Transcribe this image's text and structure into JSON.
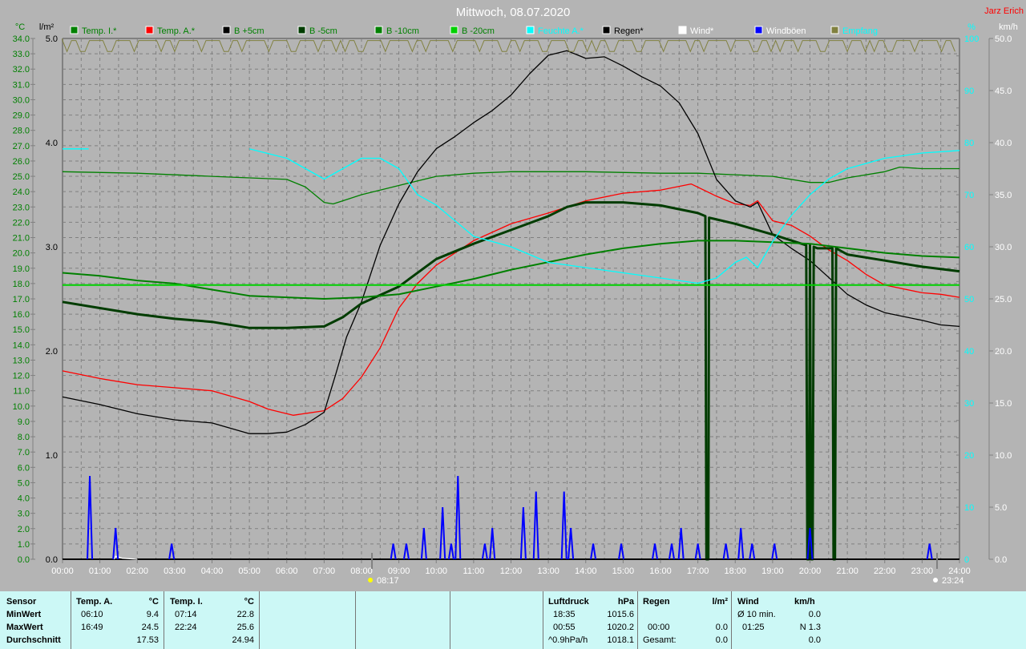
{
  "header": {
    "title": "Mittwoch, 08.07.2020",
    "author": "Jarz Erich"
  },
  "colors": {
    "temp_i": "#008000",
    "temp_a": "#ff0000",
    "b5": "#000000",
    "bm5": "#003c00",
    "bm10": "#008000",
    "bm20": "#00d000",
    "feuchte": "#00ffff",
    "regen": "#000000",
    "wind": "#ffffff",
    "windboeen": "#0000ff",
    "empfang": "#808040"
  },
  "chart_data": {
    "type": "line",
    "title": "Mittwoch, 08.07.2020",
    "xlabel": "",
    "x_range_hours": [
      0,
      24
    ],
    "x_ticks": [
      "00:00",
      "01:00",
      "02:00",
      "03:00",
      "04:00",
      "05:00",
      "06:00",
      "07:00",
      "08:00",
      "09:00",
      "10:00",
      "11:00",
      "12:00",
      "13:00",
      "14:00",
      "15:00",
      "16:00",
      "17:00",
      "18:00",
      "19:00",
      "20:00",
      "21:00",
      "22:00",
      "23:00",
      "24:00"
    ],
    "axes": {
      "temp": {
        "unit": "°C",
        "range": [
          0,
          34
        ],
        "ticks": [
          "0.0",
          "1.0",
          "2.0",
          "3.0",
          "4.0",
          "5.0",
          "6.0",
          "7.0",
          "8.0",
          "9.0",
          "10.0",
          "11.0",
          "12.0",
          "13.0",
          "14.0",
          "15.0",
          "16.0",
          "17.0",
          "18.0",
          "19.0",
          "20.0",
          "21.0",
          "22.0",
          "23.0",
          "24.0",
          "25.0",
          "26.0",
          "27.0",
          "28.0",
          "29.0",
          "30.0",
          "31.0",
          "32.0",
          "33.0",
          "34.0"
        ]
      },
      "rain": {
        "unit": "l/m²",
        "range": [
          0,
          5
        ],
        "ticks": [
          "0.0",
          "1.0",
          "2.0",
          "3.0",
          "4.0",
          "5.0"
        ]
      },
      "humidity": {
        "unit": "%",
        "range": [
          0,
          100
        ],
        "ticks": [
          "0",
          "10",
          "20",
          "30",
          "40",
          "50",
          "60",
          "70",
          "80",
          "90",
          "100"
        ]
      },
      "wind": {
        "unit": "km/h",
        "range": [
          0,
          50
        ],
        "ticks": [
          "0.0",
          "5.0",
          "10.0",
          "15.0",
          "20.0",
          "25.0",
          "30.0",
          "35.0",
          "40.0",
          "45.0",
          "50.0"
        ]
      }
    },
    "grid": true,
    "legend_position": "top",
    "legend": [
      "Temp. I.*",
      "Temp. A.*",
      "B +5cm",
      "B -5cm",
      "B -10cm",
      "B -20cm",
      "Feuchte A.*",
      "Regen*",
      "Wind*",
      "Windböen",
      "Empfang"
    ],
    "series": [
      {
        "name": "Temp. I.*",
        "axis": "temp",
        "color_key": "temp_i",
        "points": [
          [
            0,
            25.3
          ],
          [
            2,
            25.2
          ],
          [
            4,
            25.0
          ],
          [
            5,
            24.9
          ],
          [
            6,
            24.8
          ],
          [
            6.5,
            24.3
          ],
          [
            7,
            23.3
          ],
          [
            7.24,
            23.2
          ],
          [
            7.5,
            23.4
          ],
          [
            8,
            23.8
          ],
          [
            9,
            24.4
          ],
          [
            10,
            25.0
          ],
          [
            11,
            25.2
          ],
          [
            12,
            25.3
          ],
          [
            14,
            25.3
          ],
          [
            16,
            25.2
          ],
          [
            17,
            25.2
          ],
          [
            18,
            25.1
          ],
          [
            19,
            25.0
          ],
          [
            20,
            24.6
          ],
          [
            20.5,
            24.6
          ],
          [
            21,
            24.9
          ],
          [
            22,
            25.3
          ],
          [
            22.4,
            25.6
          ],
          [
            23,
            25.5
          ],
          [
            24,
            25.5
          ]
        ]
      },
      {
        "name": "Temp. A.*",
        "axis": "temp",
        "color_key": "temp_a",
        "points": [
          [
            0,
            12.3
          ],
          [
            1,
            11.8
          ],
          [
            2,
            11.4
          ],
          [
            3,
            11.2
          ],
          [
            4,
            11.0
          ],
          [
            5,
            10.3
          ],
          [
            5.5,
            9.8
          ],
          [
            6.17,
            9.4
          ],
          [
            7,
            9.7
          ],
          [
            7.5,
            10.5
          ],
          [
            8,
            11.9
          ],
          [
            8.5,
            13.8
          ],
          [
            9,
            16.4
          ],
          [
            9.5,
            18
          ],
          [
            10,
            19.2
          ],
          [
            11,
            20.8
          ],
          [
            12,
            21.9
          ],
          [
            13,
            22.6
          ],
          [
            14,
            23.4
          ],
          [
            15,
            23.9
          ],
          [
            16,
            24.1
          ],
          [
            16.82,
            24.5
          ],
          [
            17.5,
            23.7
          ],
          [
            18,
            23.2
          ],
          [
            18.4,
            23.1
          ],
          [
            18.6,
            23.4
          ],
          [
            19,
            22.1
          ],
          [
            19.5,
            21.8
          ],
          [
            20,
            21.1
          ],
          [
            20.5,
            20.2
          ],
          [
            21,
            19.5
          ],
          [
            21.5,
            18.6
          ],
          [
            22,
            17.9
          ],
          [
            23,
            17.4
          ],
          [
            23.5,
            17.3
          ],
          [
            24,
            17.1
          ]
        ]
      },
      {
        "name": "B +5cm",
        "axis": "temp",
        "color_key": "b5",
        "points": [
          [
            0,
            10.6
          ],
          [
            1,
            10.1
          ],
          [
            2,
            9.5
          ],
          [
            3,
            9.1
          ],
          [
            4,
            8.9
          ],
          [
            5,
            8.2
          ],
          [
            5.5,
            8.2
          ],
          [
            6,
            8.3
          ],
          [
            6.5,
            8.8
          ],
          [
            7,
            9.6
          ],
          [
            7.3,
            12
          ],
          [
            7.6,
            14.5
          ],
          [
            8,
            16.8
          ],
          [
            8.5,
            20.5
          ],
          [
            9,
            23.2
          ],
          [
            9.5,
            25.3
          ],
          [
            10,
            26.8
          ],
          [
            10.5,
            27.6
          ],
          [
            11,
            28.5
          ],
          [
            11.5,
            29.3
          ],
          [
            12,
            30.3
          ],
          [
            12.5,
            31.7
          ],
          [
            13,
            32.9
          ],
          [
            13.5,
            33.2
          ],
          [
            13.8,
            32.9
          ],
          [
            14,
            32.7
          ],
          [
            14.5,
            32.8
          ],
          [
            15,
            32.2
          ],
          [
            15.5,
            31.5
          ],
          [
            16,
            30.9
          ],
          [
            16.5,
            29.8
          ],
          [
            17,
            27.8
          ],
          [
            17.5,
            24.8
          ],
          [
            18,
            23.4
          ],
          [
            18.4,
            23.0
          ],
          [
            18.6,
            23.3
          ],
          [
            19,
            21.2
          ],
          [
            19.5,
            20.3
          ],
          [
            20,
            19.5
          ],
          [
            20.5,
            18.4
          ],
          [
            21,
            17.3
          ],
          [
            21.5,
            16.6
          ],
          [
            22,
            16.1
          ],
          [
            23,
            15.6
          ],
          [
            23.5,
            15.3
          ],
          [
            24,
            15.2
          ]
        ]
      },
      {
        "name": "B -5cm",
        "axis": "temp",
        "color_key": "bm5",
        "width": 3,
        "points": [
          [
            0,
            16.8
          ],
          [
            1,
            16.4
          ],
          [
            2,
            16.0
          ],
          [
            3,
            15.7
          ],
          [
            4,
            15.5
          ],
          [
            5,
            15.1
          ],
          [
            6,
            15.1
          ],
          [
            7,
            15.2
          ],
          [
            7.5,
            15.8
          ],
          [
            8,
            16.7
          ],
          [
            9,
            17.8
          ],
          [
            10,
            19.6
          ],
          [
            11,
            20.6
          ],
          [
            12,
            21.5
          ],
          [
            13,
            22.4
          ],
          [
            13.5,
            23.0
          ],
          [
            14,
            23.3
          ],
          [
            15,
            23.3
          ],
          [
            16,
            23.1
          ],
          [
            17,
            22.6
          ],
          [
            17.2,
            22.4
          ],
          [
            17.23,
            0
          ],
          [
            17.28,
            0
          ],
          [
            17.3,
            22.3
          ],
          [
            18,
            21.9
          ],
          [
            19,
            21.2
          ],
          [
            19.9,
            20.5
          ],
          [
            19.93,
            0
          ],
          [
            19.97,
            0
          ],
          [
            20,
            20.5
          ],
          [
            20.03,
            0
          ],
          [
            20.07,
            0
          ],
          [
            20.1,
            20.4
          ],
          [
            20.2,
            20.3
          ],
          [
            20.6,
            20.3
          ],
          [
            20.63,
            0
          ],
          [
            20.67,
            0
          ],
          [
            20.7,
            20.3
          ],
          [
            21,
            19.9
          ],
          [
            22,
            19.5
          ],
          [
            23,
            19.1
          ],
          [
            24,
            18.8
          ]
        ]
      },
      {
        "name": "B -10cm",
        "axis": "temp",
        "color_key": "bm10",
        "width": 2,
        "points": [
          [
            0,
            18.7
          ],
          [
            1,
            18.5
          ],
          [
            2,
            18.2
          ],
          [
            3,
            18.0
          ],
          [
            4,
            17.6
          ],
          [
            5,
            17.2
          ],
          [
            6,
            17.1
          ],
          [
            7,
            17.0
          ],
          [
            8,
            17.1
          ],
          [
            9,
            17.3
          ],
          [
            10,
            17.8
          ],
          [
            11,
            18.3
          ],
          [
            12,
            18.9
          ],
          [
            13,
            19.4
          ],
          [
            14,
            19.9
          ],
          [
            15,
            20.3
          ],
          [
            16,
            20.6
          ],
          [
            17,
            20.8
          ],
          [
            18,
            20.8
          ],
          [
            19,
            20.7
          ],
          [
            20,
            20.6
          ],
          [
            21,
            20.3
          ],
          [
            22,
            20.0
          ],
          [
            23,
            19.8
          ],
          [
            24,
            19.7
          ]
        ]
      },
      {
        "name": "B -20cm",
        "axis": "temp",
        "color_key": "bm20",
        "width": 2,
        "points": [
          [
            0,
            17.9
          ],
          [
            24,
            17.9
          ]
        ]
      },
      {
        "name": "Feuchte A.*",
        "axis": "humidity",
        "color_key": "feuchte",
        "points": [
          [
            0,
            78.8
          ],
          [
            0.7,
            78.8
          ],
          null,
          [
            5,
            78.8
          ],
          [
            6,
            77
          ],
          [
            6.5,
            75
          ],
          [
            7,
            73
          ],
          [
            7.5,
            75
          ],
          [
            8,
            77
          ],
          [
            8.5,
            77
          ],
          [
            9,
            75
          ],
          [
            9.5,
            70
          ],
          [
            10,
            68
          ],
          [
            10.5,
            65
          ],
          [
            11,
            62
          ],
          [
            12,
            60
          ],
          [
            13,
            57
          ],
          [
            14,
            56
          ],
          [
            15,
            55
          ],
          [
            16,
            54
          ],
          [
            17,
            53
          ],
          [
            17.5,
            54
          ],
          [
            18,
            57
          ],
          [
            18.3,
            58
          ],
          [
            18.6,
            56
          ],
          [
            19,
            61
          ],
          [
            19.5,
            66
          ],
          [
            20,
            70
          ],
          [
            20.5,
            73
          ],
          [
            21,
            75
          ],
          [
            22,
            77
          ],
          [
            23,
            78
          ],
          [
            24,
            78.5
          ]
        ]
      },
      {
        "name": "Regen*",
        "axis": "rain",
        "color_key": "regen",
        "points": [
          [
            0,
            0
          ],
          [
            24,
            0
          ]
        ]
      },
      {
        "name": "Wind*",
        "axis": "wind",
        "color_key": "wind",
        "points": [
          [
            1.38,
            0
          ],
          [
            1.42,
            0.3
          ],
          [
            1.6,
            0.1
          ],
          [
            2,
            0
          ]
        ]
      },
      {
        "name": "Windböen",
        "axis": "wind",
        "color_key": "windboeen",
        "spikes": [
          [
            0.73,
            8.0
          ],
          [
            1.42,
            3.0
          ],
          [
            2.92,
            1.5
          ],
          [
            8.85,
            1.5
          ],
          [
            9.2,
            1.5
          ],
          [
            9.67,
            3.0
          ],
          [
            10.17,
            5.0
          ],
          [
            10.4,
            1.5
          ],
          [
            10.58,
            8.0
          ],
          [
            11.3,
            1.5
          ],
          [
            11.5,
            3.0
          ],
          [
            12.33,
            5.0
          ],
          [
            12.67,
            6.5
          ],
          [
            13.42,
            6.5
          ],
          [
            13.6,
            3.0
          ],
          [
            14.2,
            1.5
          ],
          [
            14.95,
            1.5
          ],
          [
            15.85,
            1.5
          ],
          [
            16.3,
            1.5
          ],
          [
            16.55,
            3.0
          ],
          [
            17.0,
            1.5
          ],
          [
            17.75,
            1.5
          ],
          [
            18.15,
            3.0
          ],
          [
            18.45,
            1.5
          ],
          [
            19.05,
            1.5
          ],
          [
            20.0,
            3.0
          ],
          [
            23.2,
            1.5
          ]
        ]
      },
      {
        "name": "Empfang",
        "axis": "humidity",
        "color_key": "empfang",
        "baseline": 100
      }
    ],
    "annotations": [
      {
        "label": "08:17",
        "hour": 8.28,
        "kind": "sunrise"
      },
      {
        "label": "23:24",
        "hour": 23.4,
        "kind": "moon"
      }
    ]
  },
  "table": {
    "sensor": {
      "h": "Sensor",
      "rows": [
        "MinWert",
        "MaxWert",
        "Durchschnitt"
      ]
    },
    "temp_a": {
      "h": "Temp. A.",
      "u": "°C",
      "min_t": "06:10",
      "min": "9.4",
      "max_t": "16:49",
      "max": "24.5",
      "avg": "17.53"
    },
    "temp_i": {
      "h": "Temp. I.",
      "u": "°C",
      "min_t": "07:14",
      "min": "22.8",
      "max_t": "22:24",
      "max": "25.6",
      "avg": "24.94"
    },
    "luft": {
      "h": "Luftdruck",
      "u": "hPa",
      "r1a": "18:35",
      "r1b": "1015.6",
      "r2a": "00:55",
      "r2b": "1020.2",
      "r3a": "^0.9hPa/h",
      "r3b": "1018.1"
    },
    "regen": {
      "h": "Regen",
      "u": "l/m²",
      "r2a": "00:00",
      "r2b": "0.0",
      "r3a": "Gesamt:",
      "r3b": "0.0"
    },
    "wind": {
      "h": "Wind",
      "u": "km/h",
      "r1a": "Ø 10 min.",
      "r1b": "0.0",
      "r2a": "01:25",
      "r2b": "N 1.3",
      "r3b": "0.0"
    }
  }
}
